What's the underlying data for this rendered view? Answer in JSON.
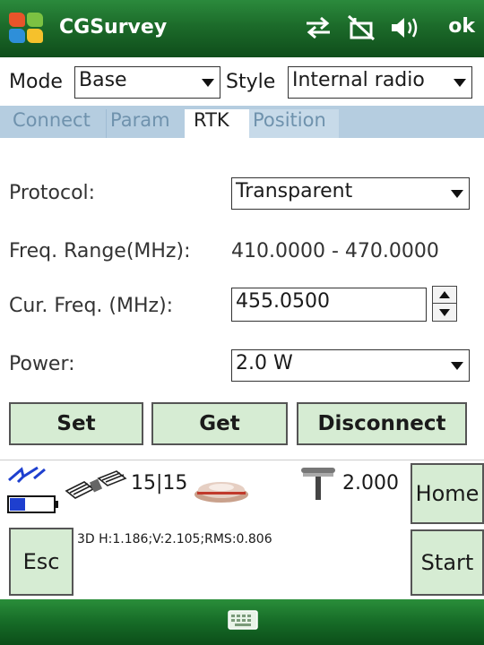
{
  "titlebar": {
    "app_title": "CGSurvey",
    "ok_label": "ok",
    "icons": [
      "start-menu-icon",
      "sync-arrows-icon",
      "connectivity-off-icon",
      "volume-icon"
    ]
  },
  "mode_row": {
    "mode_label": "Mode",
    "mode_value": "Base",
    "style_label": "Style",
    "style_value": "Internal radio"
  },
  "tabs": [
    {
      "label": "Connect",
      "active": false
    },
    {
      "label": "Param",
      "active": false
    },
    {
      "label": "RTK",
      "active": true
    },
    {
      "label": "Position",
      "active": false
    }
  ],
  "rtk": {
    "protocol_label": "Protocol:",
    "protocol_value": "Transparent",
    "freq_range_label": "Freq. Range(MHz):",
    "freq_range_value": "410.0000 - 470.0000",
    "cur_freq_label": "Cur. Freq. (MHz):",
    "cur_freq_value": "455.0500",
    "power_label": "Power:",
    "power_value": "2.0 W"
  },
  "buttons": {
    "set": "Set",
    "get": "Get",
    "disconnect": "Disconnect"
  },
  "status": {
    "satellites": "15|15",
    "antenna_height": "2.000",
    "gps_text": "3D H:1.186;V:2.105;RMS:0.806",
    "battery_level": 0.35,
    "home_label": "Home",
    "esc_label": "Esc",
    "start_label": "Start"
  },
  "colors": {
    "titlebar_green": "#1c6b2a",
    "button_fill": "#d6ecd3",
    "tab_strip": "#b5cde0",
    "battery_blue": "#1e3fcf"
  }
}
